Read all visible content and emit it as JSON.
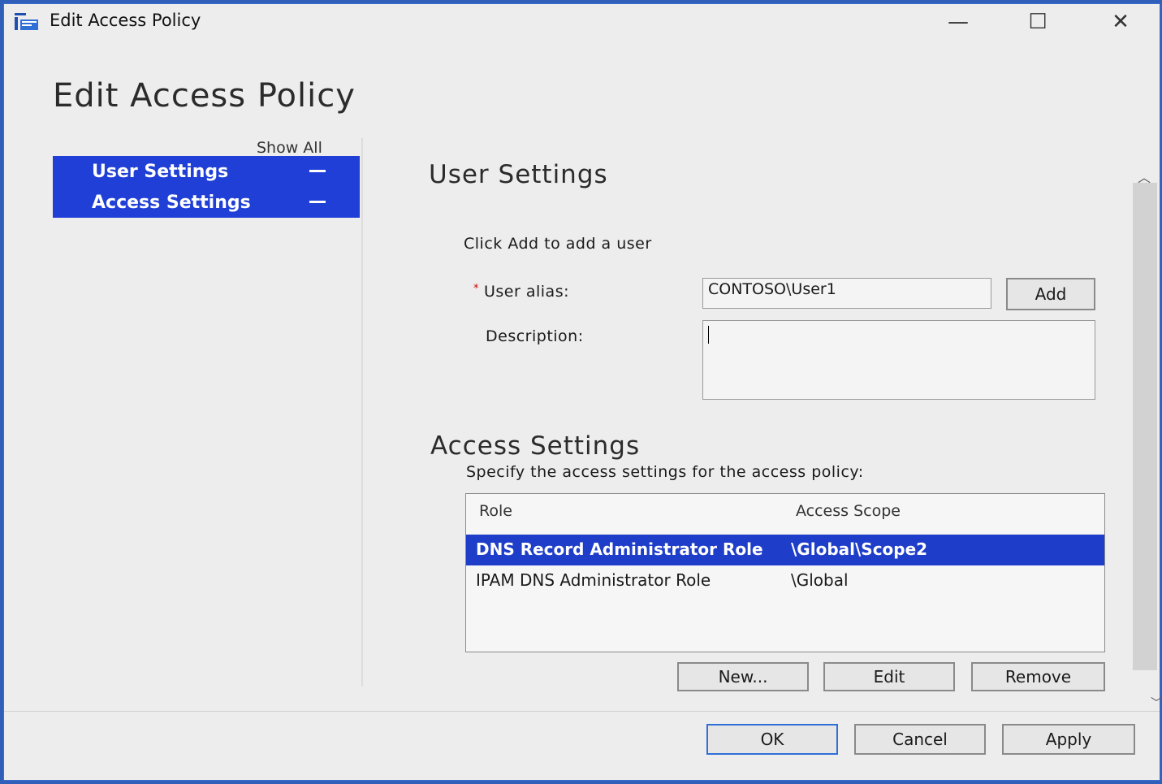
{
  "window": {
    "title": "Edit Access Policy",
    "controls": {
      "minimize": "—",
      "maximize": "☐",
      "close": "✕"
    }
  },
  "page": {
    "heading": "Edit Access Policy"
  },
  "nav": {
    "show_all": "Show All",
    "items": [
      {
        "label": "User Settings"
      },
      {
        "label": "Access Settings"
      }
    ]
  },
  "user_settings": {
    "title": "User Settings",
    "instruction": "Click Add to add a user",
    "alias_label": "User alias:",
    "alias_required_mark": "*",
    "alias_value": "CONTOSO\\User1",
    "add_button": "Add",
    "description_label": "Description:",
    "description_value": ""
  },
  "access_settings": {
    "title": "Access Settings",
    "instruction": "Specify the access settings for the access policy:",
    "columns": [
      "Role",
      "Access Scope"
    ],
    "rows": [
      {
        "role": "DNS Record Administrator Role",
        "scope": "\\Global\\Scope2",
        "selected": true
      },
      {
        "role": "IPAM DNS Administrator Role",
        "scope": "\\Global",
        "selected": false
      }
    ],
    "buttons": {
      "new": "New...",
      "edit": "Edit",
      "remove": "Remove"
    }
  },
  "footer": {
    "ok": "OK",
    "cancel": "Cancel",
    "apply": "Apply"
  },
  "colors": {
    "selection": "#1e3dc9",
    "nav_bg": "#1f3fd6",
    "window_bg": "#ededed"
  }
}
